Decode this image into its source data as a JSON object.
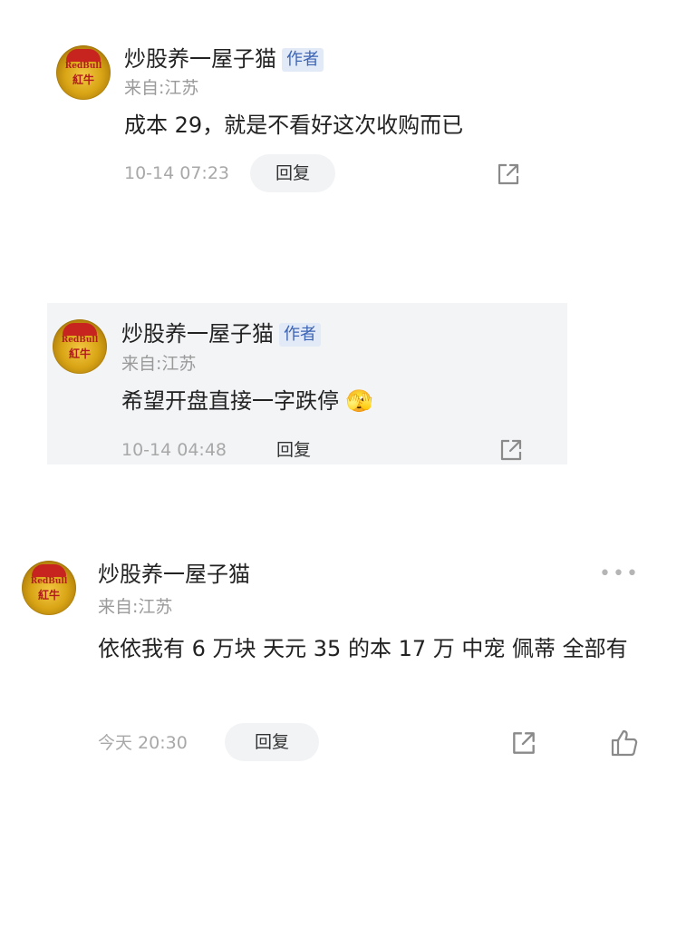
{
  "comments": [
    {
      "username": "炒股养一屋子猫",
      "badge": "作者",
      "location": "来自:江苏",
      "text": "成本 29，就是不看好这次收购而已",
      "time": "10-14 07:23",
      "reply_label": "回复",
      "share_icon": "share-icon"
    },
    {
      "username": "炒股养一屋子猫",
      "badge": "作者",
      "location": "来自:江苏",
      "text": "希望开盘直接一字跌停",
      "emoji": "🫣",
      "time": "10-14 04:48",
      "reply_label": "回复",
      "share_icon": "share-icon"
    },
    {
      "username": "炒股养一屋子猫",
      "location": "来自:江苏",
      "text": "依依我有 6 万块 天元 35 的本 17 万 中宠 佩蒂 全部有",
      "time": "今天 20:30",
      "reply_label": "回复",
      "share_icon": "share-icon",
      "like_icon": "thumbs-up-icon",
      "more_icon": "more-dots-icon"
    }
  ],
  "avatar": {
    "line1": "RedBull",
    "line2": "紅牛"
  },
  "colors": {
    "badge_text": "#3c64b4",
    "badge_bg": "#e3eaf7",
    "quote_bg": "#f3f4f6",
    "reply_bg": "#f2f3f5"
  }
}
